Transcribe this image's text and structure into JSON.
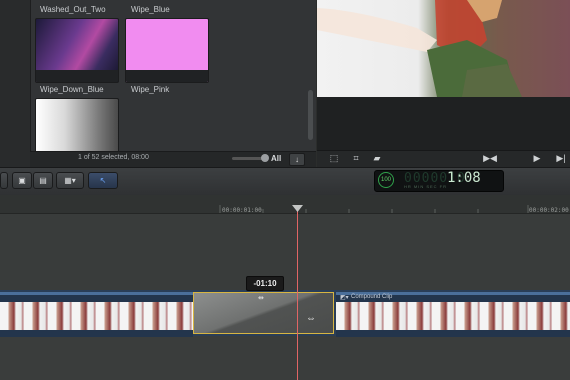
{
  "browser": {
    "items": [
      {
        "label": "Washed_Out_Two"
      },
      {
        "label": "Wipe_Blue"
      },
      {
        "label": "Wipe_Down_Blue"
      },
      {
        "label": "Wipe_Pink"
      }
    ],
    "selection_status": "1 of 52 selected, 08:00",
    "filter_label": "All",
    "menu_glyph": "↓"
  },
  "viewer": {
    "controls": [
      "▶◀",
      "▶",
      "▶|"
    ]
  },
  "toolbar": {
    "select_tool_glyph": "↖",
    "timecode": {
      "dim_digits": "0000010",
      "value": "1:08",
      "rate": "100",
      "sub_labels": "HR MIN SEC FR"
    }
  },
  "timeline": {
    "ruler_labels": [
      "00:00:01:00",
      "00:00:02:00"
    ],
    "transition_duration": "-01:10",
    "compound_clip_name": "Compound Clip"
  },
  "colors": {
    "accent_blue": "#4b6f9a",
    "transition_border": "#d7b542",
    "playhead": "#e06565"
  }
}
